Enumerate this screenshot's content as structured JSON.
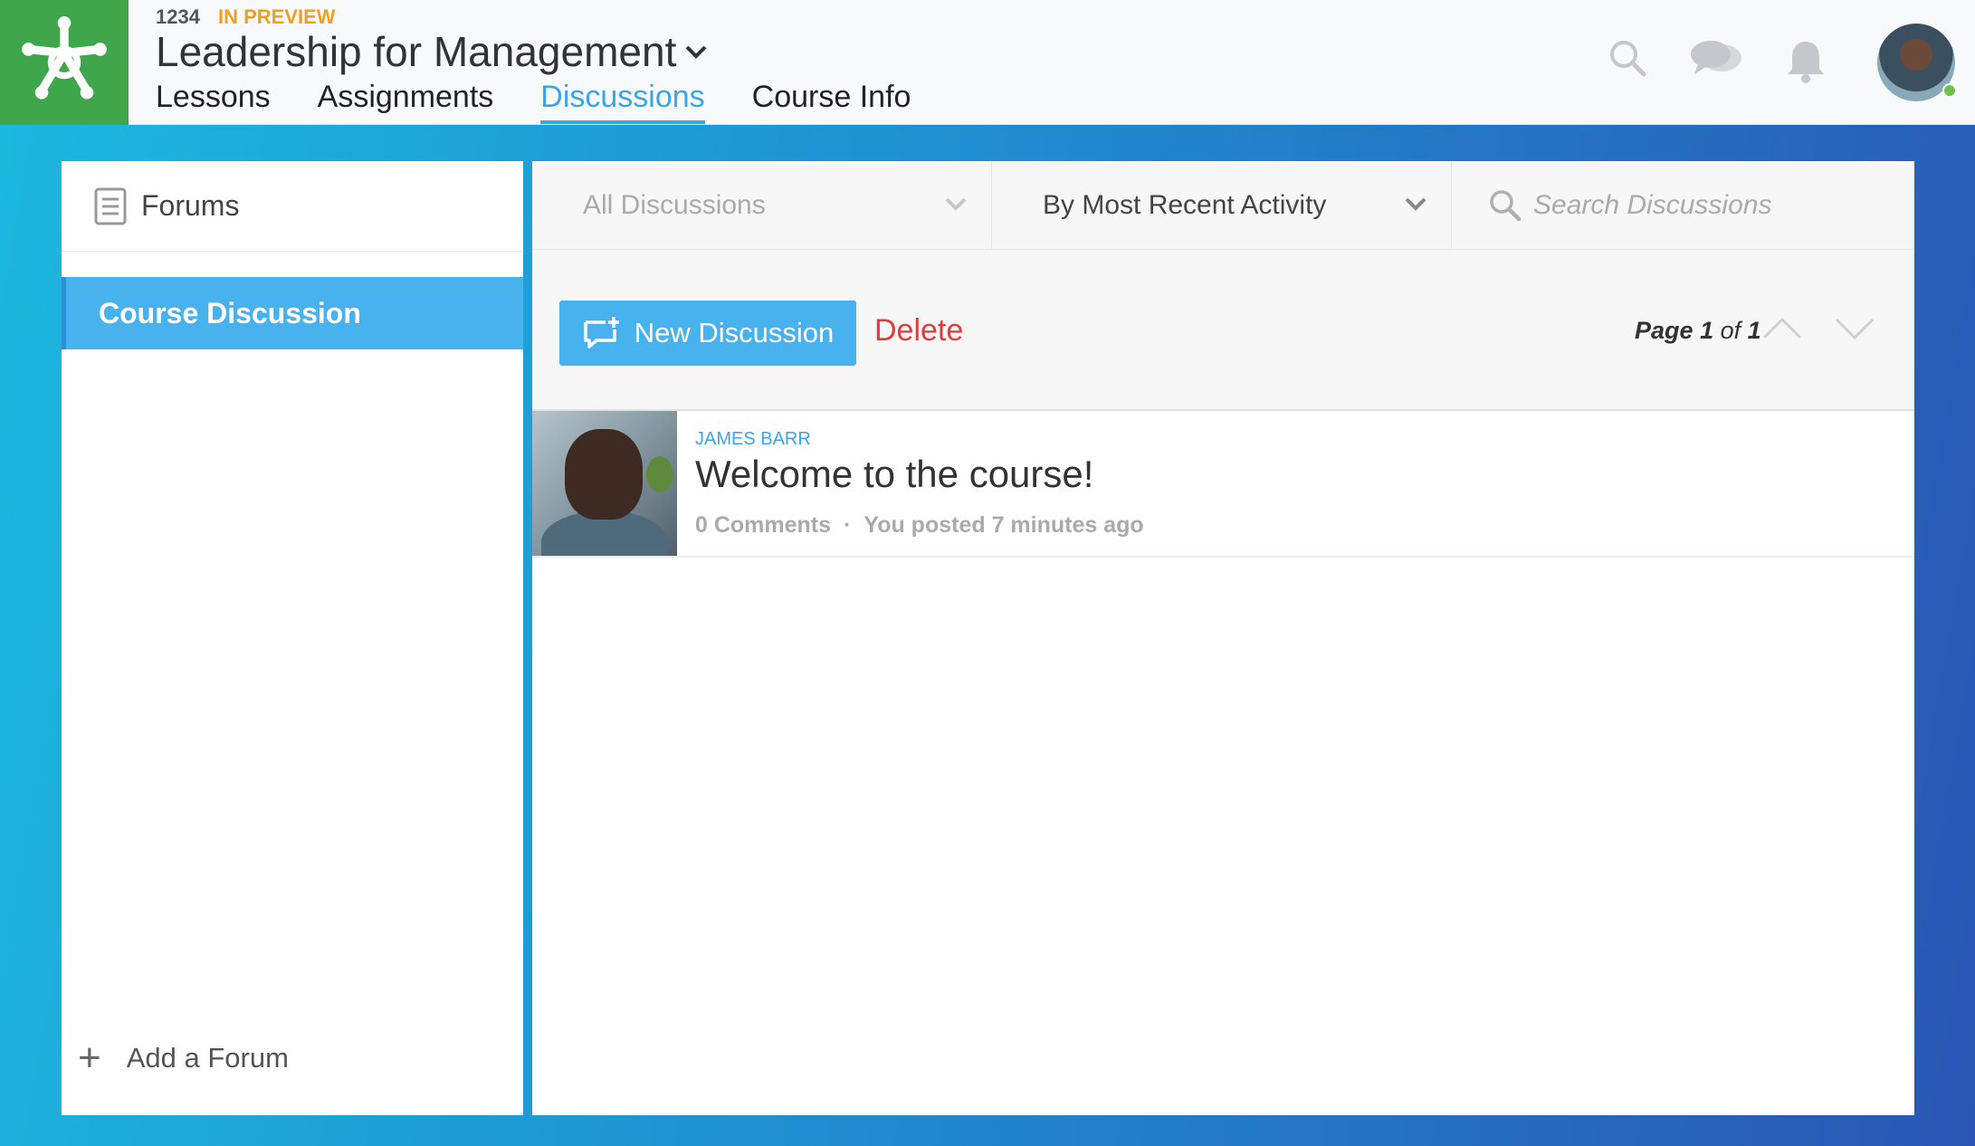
{
  "header": {
    "course_code": "1234",
    "status": "IN PREVIEW",
    "course_title": "Leadership for Management",
    "tabs": [
      {
        "label": "Lessons"
      },
      {
        "label": "Assignments"
      },
      {
        "label": "Discussions",
        "active": true
      },
      {
        "label": "Course Info"
      }
    ],
    "icons": [
      "search-icon",
      "chat-icon",
      "bell-icon"
    ]
  },
  "sidebar": {
    "heading": "Forums",
    "items": [
      {
        "label": "Course Discussion",
        "selected": true
      }
    ],
    "add_label": "Add a Forum"
  },
  "main": {
    "filter_label": "All Discussions",
    "sort_label": "By Most Recent Activity",
    "search_placeholder": "Search Discussions",
    "new_button": "New Discussion",
    "delete_button": "Delete",
    "pager": {
      "word_page": "Page",
      "current": "1",
      "word_of": "of",
      "total": "1"
    },
    "posts": [
      {
        "author": "JAMES BARR",
        "title": "Welcome to the course!",
        "comments": "0 Comments",
        "separator": "·",
        "posted": "You posted 7 minutes ago"
      }
    ]
  },
  "colors": {
    "accent": "#47b2ee",
    "brand_green": "#3fa64c",
    "preview_orange": "#f0a020",
    "delete_red": "#e03c3c",
    "online_green": "#6cc24a"
  }
}
